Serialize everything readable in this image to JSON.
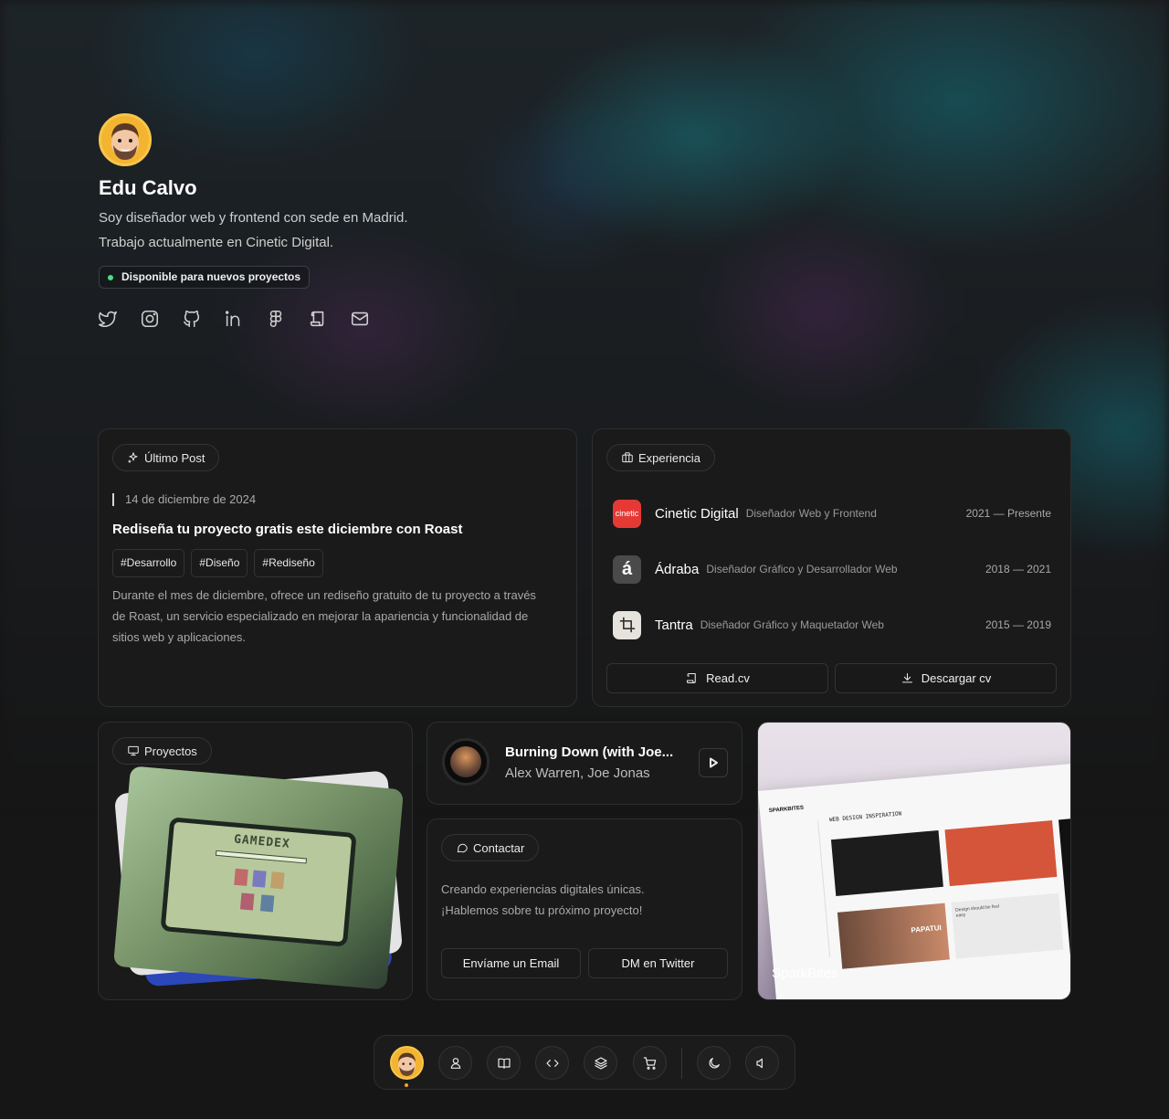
{
  "profile": {
    "name": "Edu Calvo",
    "bio_line1": "Soy diseñador web y frontend con sede en Madrid.",
    "bio_line2": "Trabajo actualmente en Cinetic Digital.",
    "availability": "Disponible para nuevos proyectos",
    "availability_color": "#4ade80",
    "avatar_icon": "avatar-cartoon",
    "socials": [
      "twitter-icon",
      "instagram-icon",
      "github-icon",
      "linkedin-icon",
      "figma-icon",
      "readcv-icon",
      "mail-icon"
    ]
  },
  "post": {
    "badge": "Último Post",
    "date": "14 de diciembre de 2024",
    "title": "Rediseña tu proyecto gratis este diciembre con Roast",
    "tags": [
      "#Desarrollo",
      "#Diseño",
      "#Rediseño"
    ],
    "body": "Durante el mes de diciembre, ofrece un rediseño gratuito de tu proyecto a través de Roast, un servicio especializado en mejorar la apariencia y funcionalidad de sitios web y aplicaciones."
  },
  "experience": {
    "badge": "Experiencia",
    "items": [
      {
        "company": "Cinetic Digital",
        "role": "Diseñador Web y Frontend",
        "years": "2021 — Presente",
        "logo_text": "cinetic",
        "logo_color": "#e53935"
      },
      {
        "company": "Ádraba",
        "role": "Diseñador Gráfico y Desarrollador Web",
        "years": "2018 — 2021",
        "logo_text": "á",
        "logo_color": "#4a4a4a"
      },
      {
        "company": "Tantra",
        "role": "Diseñador Gráfico y Maquetador Web",
        "years": "2015 — 2019",
        "logo_text": "",
        "logo_color": "#e6e2dc"
      }
    ],
    "readcv_label": "Read.cv",
    "download_label": "Descargar cv"
  },
  "projects": {
    "badge": "Proyectos",
    "image_title": "GAMEDEX"
  },
  "music": {
    "title": "Burning Down (with Joe...",
    "artist": "Alex Warren, Joe Jonas"
  },
  "contact": {
    "badge": "Contactar",
    "line1": "Creando experiencias digitales únicas.",
    "line2": "¡Hablemos sobre tu próximo proyecto!",
    "email_button": "Envíame un Email",
    "twitter_button": "DM en Twitter"
  },
  "sparkbites": {
    "label": "SparkBites",
    "brand": "SPARKBITES",
    "heading": "WEB DESIGN INSPIRATION",
    "feature_text": "PAPATUI",
    "feature_caption": "Design should be feel easy"
  },
  "dock": {
    "items": [
      "avatar-icon",
      "user-icon",
      "book-icon",
      "code-icon",
      "layers-icon",
      "cart-icon",
      "moon-icon",
      "speaker-icon"
    ],
    "active_color": "#f5a524"
  }
}
